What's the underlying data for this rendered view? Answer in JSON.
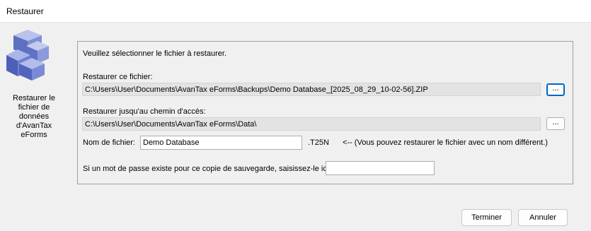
{
  "window": {
    "title": "Restaurer"
  },
  "side": {
    "icon": "database-cubes-icon",
    "label_lines": [
      "Restaurer le",
      "fichier de",
      "données",
      "d'AvanTax",
      "eForms"
    ]
  },
  "form": {
    "instruction": "Veuillez sélectionner le fichier à restaurer.",
    "restore_file_label": "Restaurer ce fichier:",
    "restore_file_value": "C:\\Users\\User\\Documents\\AvanTax eForms\\Backups\\Demo Database_[2025_08_29_10-02-56].ZIP",
    "restore_path_label": "Restaurer jusqu'au chemin d'accès:",
    "restore_path_value": "C:\\Users\\User\\Documents\\AvanTax eForms\\Data\\",
    "browse_label": "...",
    "filename_label": "Nom de fichier:",
    "filename_value": "Demo Database",
    "extension": ".T25N",
    "filename_hint": "<-- (Vous pouvez restaurer le fichier avec un nom différent.)",
    "password_label": "Si un mot de passe existe pour ce copie de sauvegarde, saisissez-le ici :",
    "password_value": ""
  },
  "buttons": {
    "finish": "Terminer",
    "cancel": "Annuler"
  }
}
